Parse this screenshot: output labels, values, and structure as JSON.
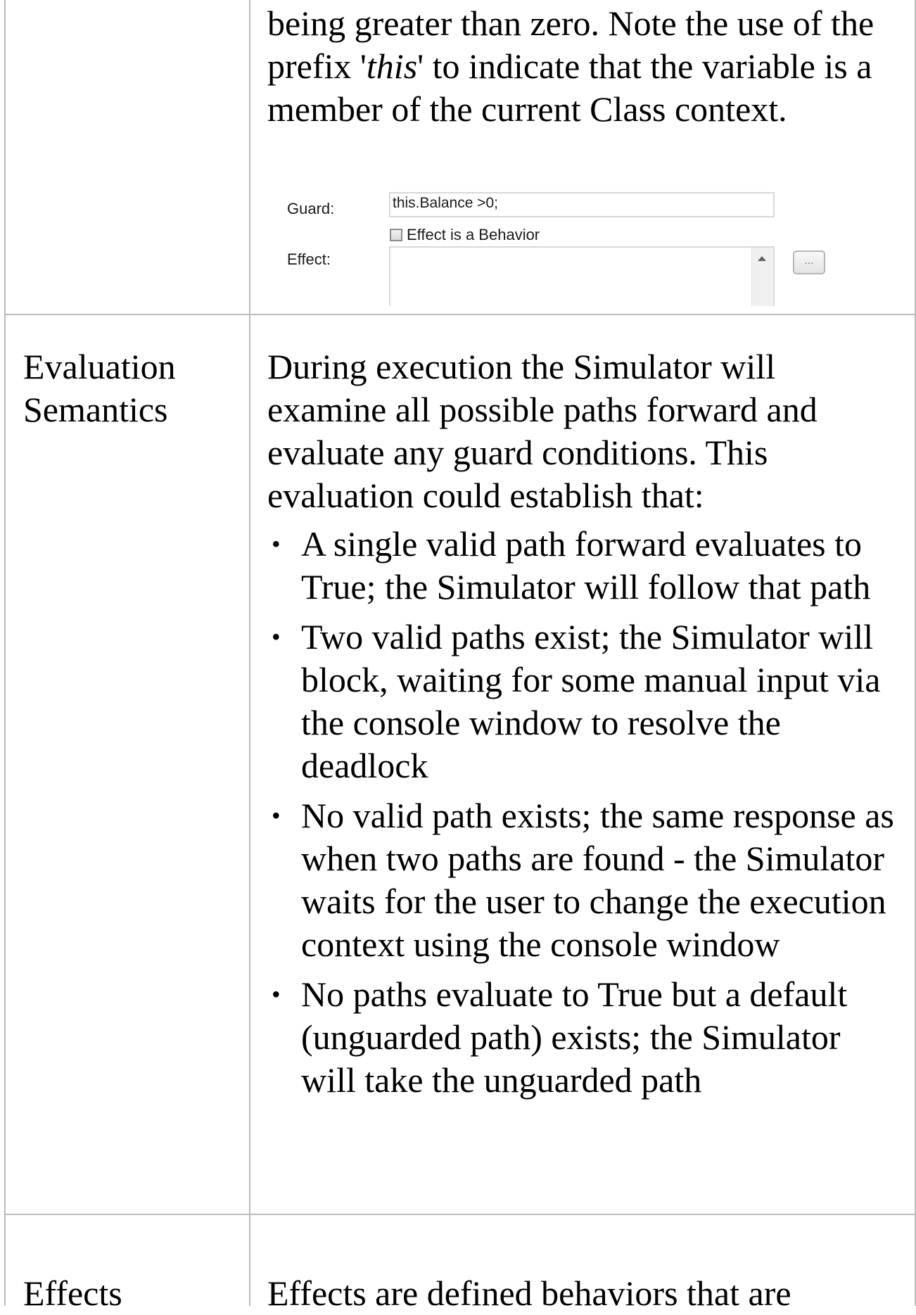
{
  "rows": [
    {
      "label": "",
      "intro_pre": "being greater than zero. Note the use of the prefix '",
      "intro_em": "this",
      "intro_post": "' to indicate that the variable is a member of the current Class context.",
      "dialog": {
        "guard_label": "Guard:",
        "guard_value": "this.Balance >0;",
        "checkbox_label": "Effect is a Behavior",
        "checkbox_checked": false,
        "effect_label": "Effect:",
        "browse_button": "...",
        "scroll_up_icon": "chevron-up-icon"
      }
    },
    {
      "label_line1": "Evaluation",
      "label_line2": "Semantics",
      "intro": "During execution the Simulator will examine all possible paths forward and evaluate any guard conditions. This evaluation could establish that:",
      "bullets": [
        "A single valid path forward evaluates to True; the Simulator will follow that path",
        "Two valid paths exist; the Simulator will block, waiting for some manual input via the console window to resolve the deadlock",
        "No valid path exists; the same response as when two paths are found - the Simulator waits for the user to change the execution context using the console window",
        "No paths evaluate to True but a default (unguarded path) exists; the Simulator will take the unguarded path"
      ]
    },
    {
      "label": "Effects",
      "intro": "Effects are defined behaviors that are"
    }
  ]
}
